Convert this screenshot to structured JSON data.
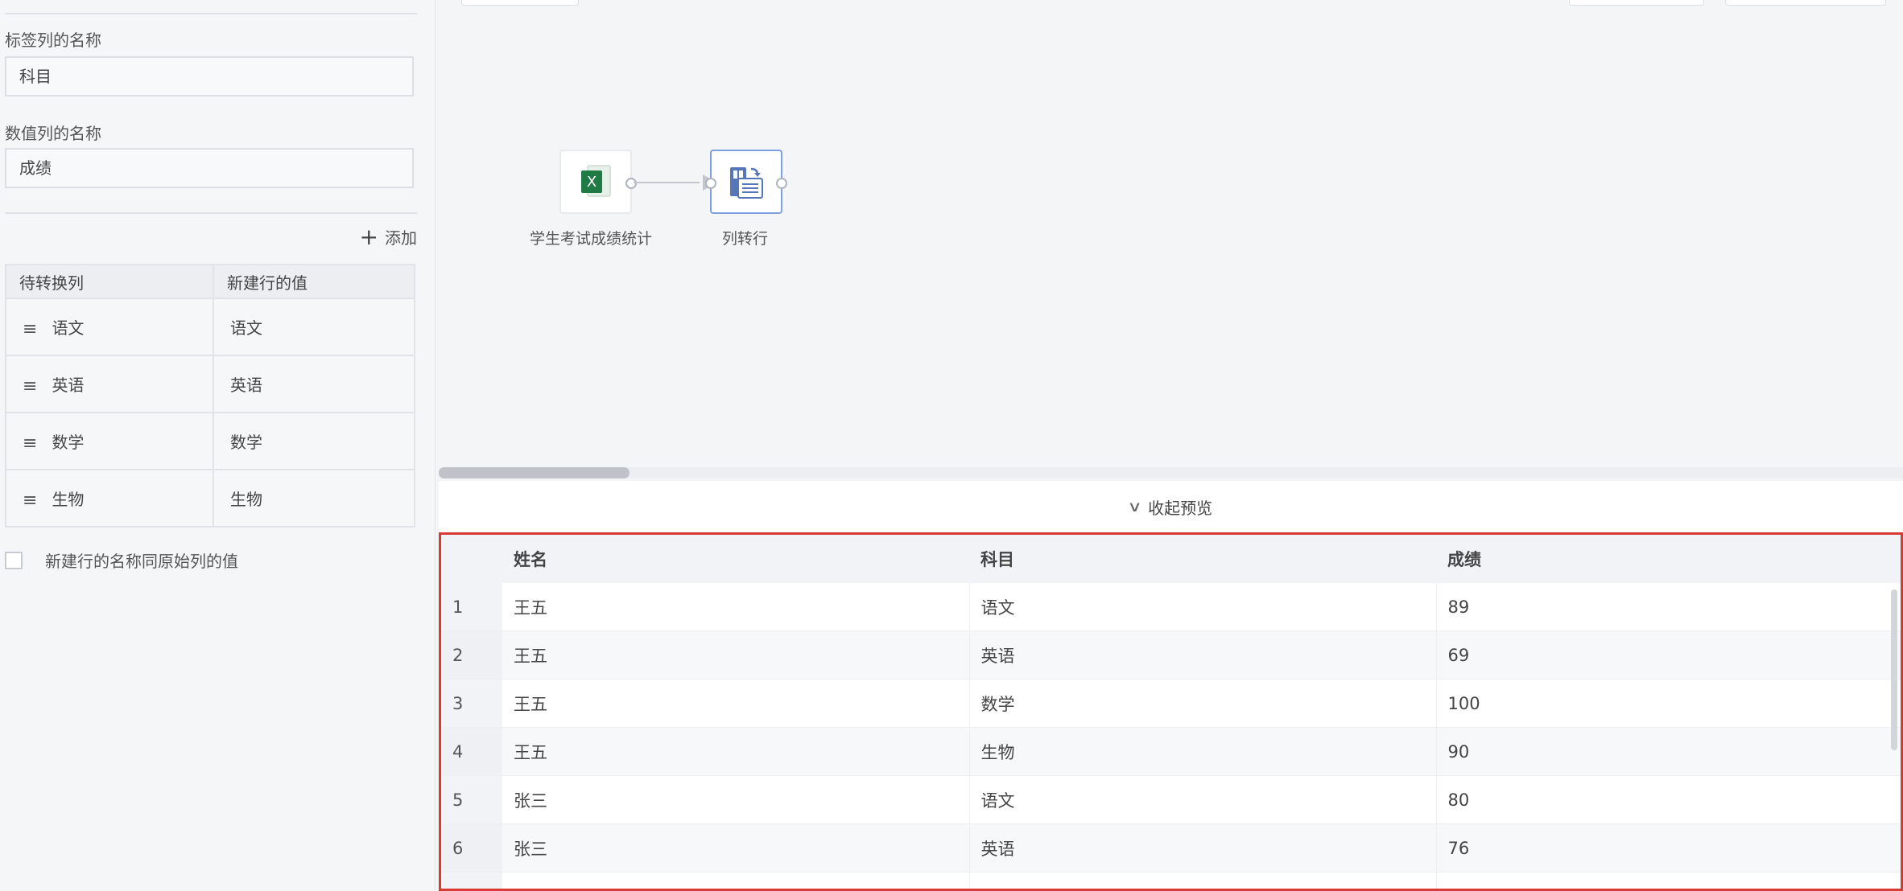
{
  "config": {
    "label_col_title": "标签列的名称",
    "label_col_value": "科目",
    "value_col_title": "数值列的名称",
    "value_col_value": "成绩",
    "add_label": "添加",
    "mapping_headers": [
      "待转换列",
      "新建行的值"
    ],
    "mapping_rows": [
      {
        "column": "语文",
        "value": "语文"
      },
      {
        "column": "英语",
        "value": "英语"
      },
      {
        "column": "数学",
        "value": "数学"
      },
      {
        "column": "生物",
        "value": "生物"
      }
    ],
    "checkbox_label": "新建行的名称同原始列的值"
  },
  "canvas": {
    "source_node_label": "学生考试成绩统计",
    "transform_node_label": "列转行",
    "icons": {
      "source": "excel-icon",
      "transform": "column-to-row-icon"
    }
  },
  "preview": {
    "collapse_label": "收起预览",
    "headers": [
      "姓名",
      "科目",
      "成绩"
    ],
    "rows": [
      {
        "n": "1",
        "name": "王五",
        "subject": "语文",
        "score": "89"
      },
      {
        "n": "2",
        "name": "王五",
        "subject": "英语",
        "score": "69"
      },
      {
        "n": "3",
        "name": "王五",
        "subject": "数学",
        "score": "100"
      },
      {
        "n": "4",
        "name": "王五",
        "subject": "生物",
        "score": "90"
      },
      {
        "n": "5",
        "name": "张三",
        "subject": "语文",
        "score": "80"
      },
      {
        "n": "6",
        "name": "张三",
        "subject": "英语",
        "score": "76"
      }
    ]
  },
  "colors": {
    "highlight_border": "#d93a32",
    "selected_node": "#7ea0e0",
    "excel_green": "#1f7a44"
  }
}
